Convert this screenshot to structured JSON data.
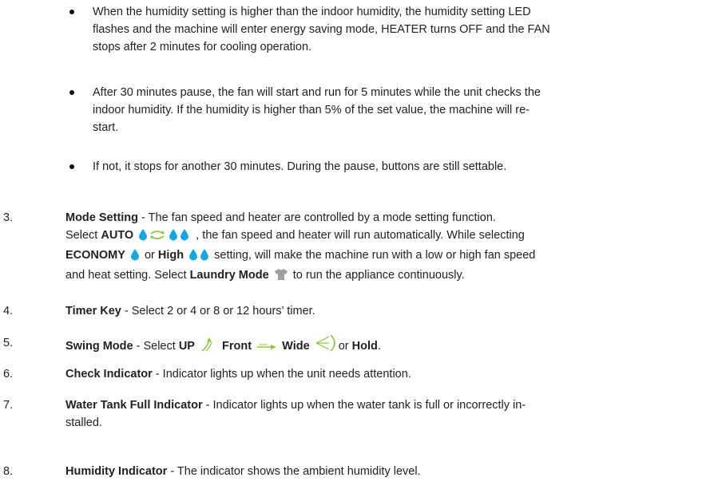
{
  "bullets": [
    {
      "lines": [
        "When the humidity setting is higher than the indoor humidity, the humidity setting LED",
        "flashes and the machine will enter energy saving mode, HEATER turns OFF and the FAN",
        "stops after 2 minutes for cooling operation."
      ]
    },
    {
      "lines": [
        "After 30 minutes pause, the fan will start and run for 5 minutes while the unit checks the",
        "indoor humidity. If the humidity is higher than 5% of the set value, the machine will re-",
        "start."
      ]
    },
    {
      "lines": [
        " If not, it stops for another 30 minutes. During the pause, buttons are still settable."
      ]
    }
  ],
  "items": {
    "mode": {
      "num": "3.",
      "title": "Mode Setting",
      "l1_rest": " - The fan speed and heater are controlled  by a mode setting function.",
      "l2_a": "Select ",
      "auto": "AUTO",
      "l2_b": " , the fan speed and heater will run automatically.  While selecting",
      "economy": "ECONOMY",
      "or": " or ",
      "high": "High",
      "l3_b": " setting,  will make the machine run with a low or high fan speed",
      "l4_a": "and heat setting. Select ",
      "laundry": "Laundry Mode",
      "l4_b": " to run the appliance continuously."
    },
    "timer": {
      "num": "4.",
      "title": "Timer Key",
      "rest": " - Select 2 or 4 or 8 or 12 hours’ timer."
    },
    "swing": {
      "num": "5.",
      "title": "Swing Mode",
      "a": " - Select ",
      "up": "UP",
      "front": "Front",
      "wide": "Wide",
      "or": "or ",
      "hold": "Hold",
      "end": "."
    },
    "check": {
      "num": "6.",
      "title": "Check Indicator",
      "rest": " - Indicator lights up when the unit needs attention."
    },
    "tank": {
      "num": "7.",
      "title": "Water Tank Full Indicator",
      "rest": " - Indicator lights up when the water tank is full or incorrectly in-",
      "rest2": "stalled."
    },
    "humidity": {
      "num": "8.",
      "title": "Humidity Indicator",
      "rest": " - The indicator shows the ambient humidity level."
    }
  },
  "colors": {
    "drop": "#1aa5dc",
    "swing_icon": "#8cc63f",
    "laundry_icon": "#a0a0a0"
  },
  "icons": [
    "water-drop-icon",
    "cycle-arrows-icon",
    "swing-up-icon",
    "swing-front-icon",
    "swing-wide-icon",
    "shirt-icon"
  ]
}
